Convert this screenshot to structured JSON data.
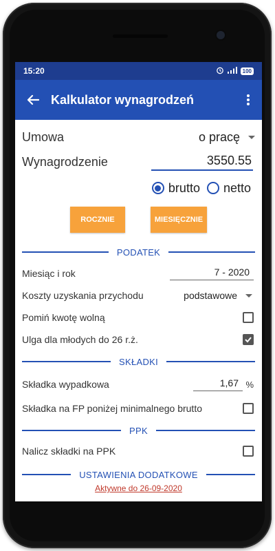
{
  "status": {
    "time": "15:20",
    "battery": "100"
  },
  "appbar": {
    "title": "Kalkulator wynagrodzeń"
  },
  "form": {
    "contract_label": "Umowa",
    "contract_value": "o pracę",
    "salary_label": "Wynagrodzenie",
    "salary_value": "3550.55",
    "gross_label": "brutto",
    "net_label": "netto",
    "selected_mode": "brutto",
    "annual_button": "ROCZNIE",
    "monthly_button": "MIESIĘCZNIE"
  },
  "tax_section": {
    "title": "PODATEK",
    "month_year_label": "Miesiąc i rok",
    "month_year_value": "7 - 2020",
    "costs_label": "Koszty uzyskania przychodu",
    "costs_value": "podstawowe",
    "skip_free_amount_label": "Pomiń kwotę wolną",
    "skip_free_amount_checked": false,
    "youth_relief_label": "Ulga dla młodych do 26 r.ż.",
    "youth_relief_checked": true
  },
  "contributions_section": {
    "title": "SKŁADKI",
    "accident_label": "Składka wypadkowa",
    "accident_value": "1,67",
    "accident_unit": "%",
    "fp_label": "Składka na FP poniżej minimalnego brutto",
    "fp_checked": false
  },
  "ppk_section": {
    "title": "PPK",
    "ppk_label": "Nalicz składki na PPK",
    "ppk_checked": false
  },
  "extra_section": {
    "title": "USTAWIENIA DODATKOWE",
    "active_until": "Aktywne do 26-09-2020"
  },
  "colors": {
    "primary": "#2350b4",
    "status_bar": "#1e3d8f",
    "accent_button": "#f7a23b",
    "link_red": "#c0392b"
  }
}
